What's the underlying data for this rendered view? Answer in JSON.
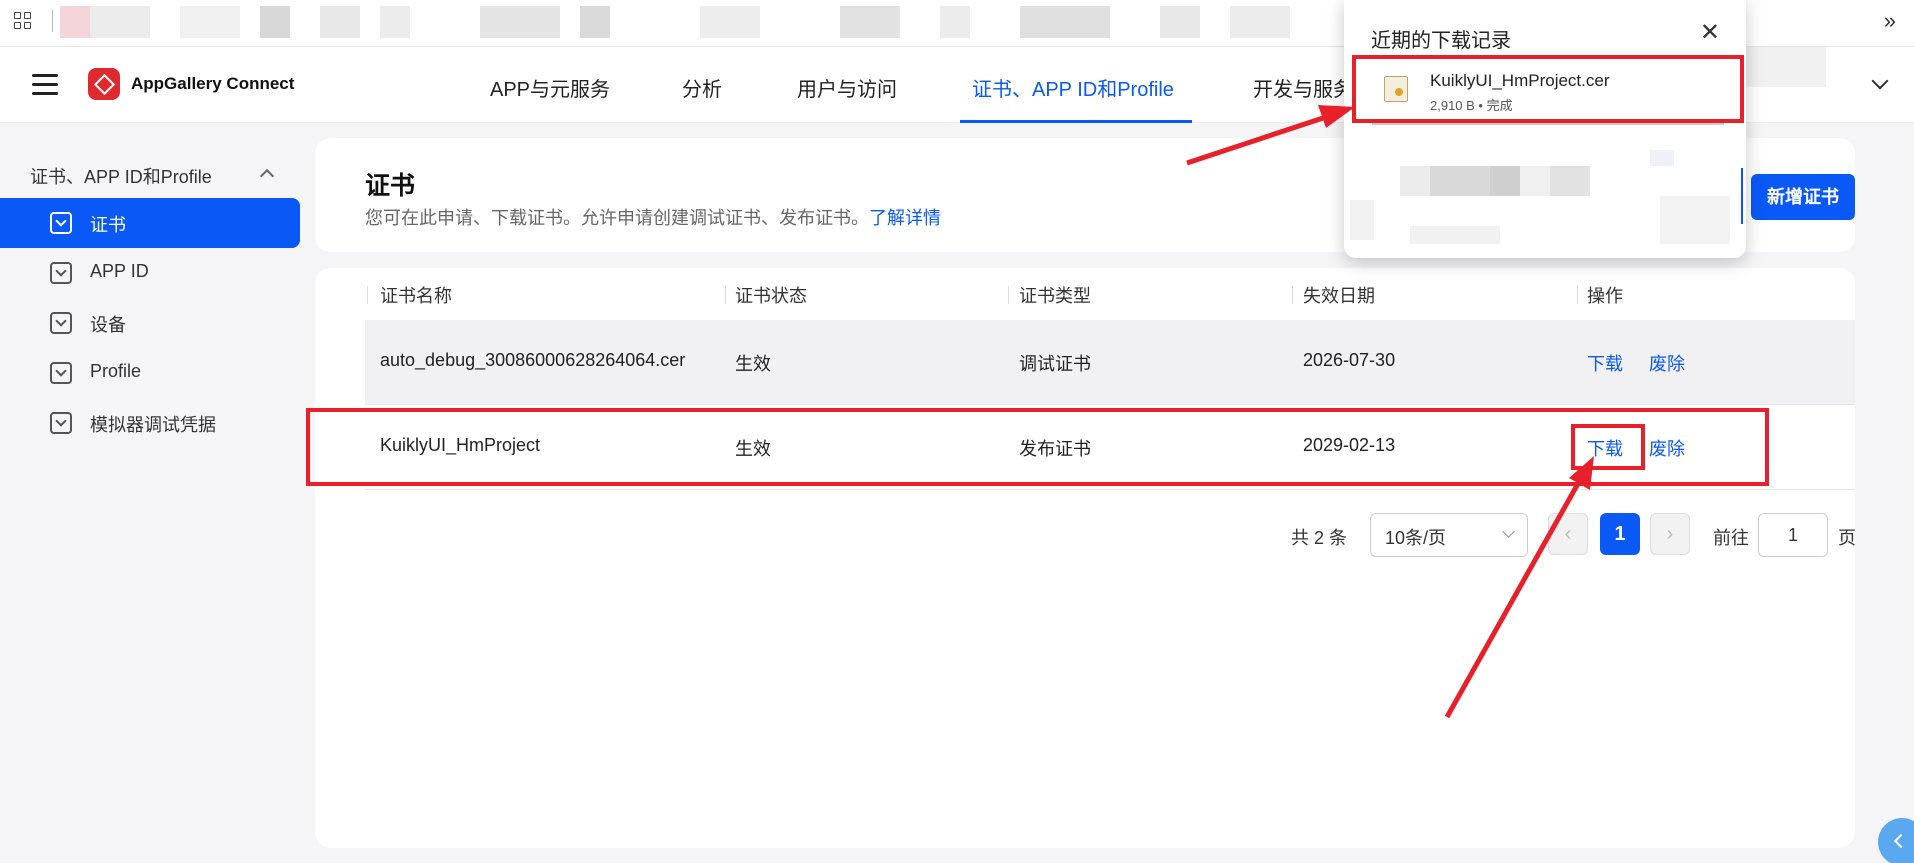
{
  "browser": {
    "apps_icon": "apps-grid-icon",
    "overflow_icon": "»"
  },
  "nav": {
    "brand": "AppGallery Connect",
    "tabs": [
      {
        "label": "APP与元服务"
      },
      {
        "label": "分析"
      },
      {
        "label": "用户与访问"
      },
      {
        "label": "证书、APP ID和Profile"
      },
      {
        "label": "开发与服务"
      }
    ],
    "active_tab": "证书、APP ID和Profile"
  },
  "sidebar": {
    "group_label": "证书、APP ID和Profile",
    "items": [
      {
        "label": "证书",
        "active": true
      },
      {
        "label": "APP ID",
        "active": false
      },
      {
        "label": "设备",
        "active": false
      },
      {
        "label": "Profile",
        "active": false
      },
      {
        "label": "模拟器调试凭据",
        "active": false
      }
    ]
  },
  "header": {
    "title": "证书",
    "description": "您可在此申请、下载证书。允许申请创建调试证书、发布证书。",
    "learn_more": "了解详情",
    "new_button": "新增证书"
  },
  "table": {
    "columns": [
      "证书名称",
      "证书状态",
      "证书类型",
      "失效日期",
      "操作"
    ],
    "rows": [
      {
        "name": "auto_debug_30086000628264064.cer",
        "status": "生效",
        "type": "调试证书",
        "expiry": "2026-07-30",
        "download": "下载",
        "revoke": "废除"
      },
      {
        "name": "KuiklyUI_HmProject",
        "status": "生效",
        "type": "发布证书",
        "expiry": "2029-02-13",
        "download": "下载",
        "revoke": "废除"
      }
    ]
  },
  "pagination": {
    "total": "共 2 条",
    "page_size": "10条/页",
    "prev": "‹",
    "current": "1",
    "next": "›",
    "goto_label": "前往",
    "goto_value": "1",
    "page_suffix": "页"
  },
  "downloads": {
    "title": "近期的下载记录",
    "close": "✕",
    "item": {
      "filename": "KuiklyUI_HmProject.cer",
      "meta": "2,910 B • 完成"
    }
  },
  "colors": {
    "accent": "#0a59f7",
    "annotation_red": "#e8202a",
    "brand_red": "#e0292e"
  }
}
